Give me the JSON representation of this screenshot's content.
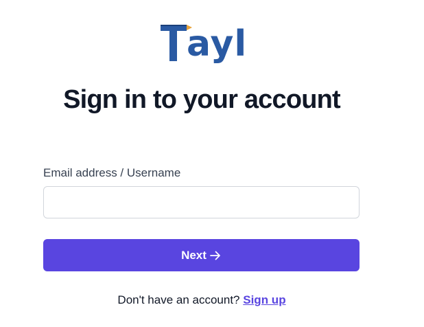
{
  "logo": {
    "text": "ayl",
    "brand_color": "#2a5aa3",
    "accent_color": "#e8a33a"
  },
  "title": "Sign in to your account",
  "form": {
    "email_label": "Email address / Username",
    "email_value": "",
    "email_placeholder": "",
    "next_label": "Next",
    "next_icon": "arrow-right-icon",
    "button_color": "#5945e0"
  },
  "footer": {
    "prompt": "Don't have an account?",
    "signup_label": "Sign up"
  }
}
